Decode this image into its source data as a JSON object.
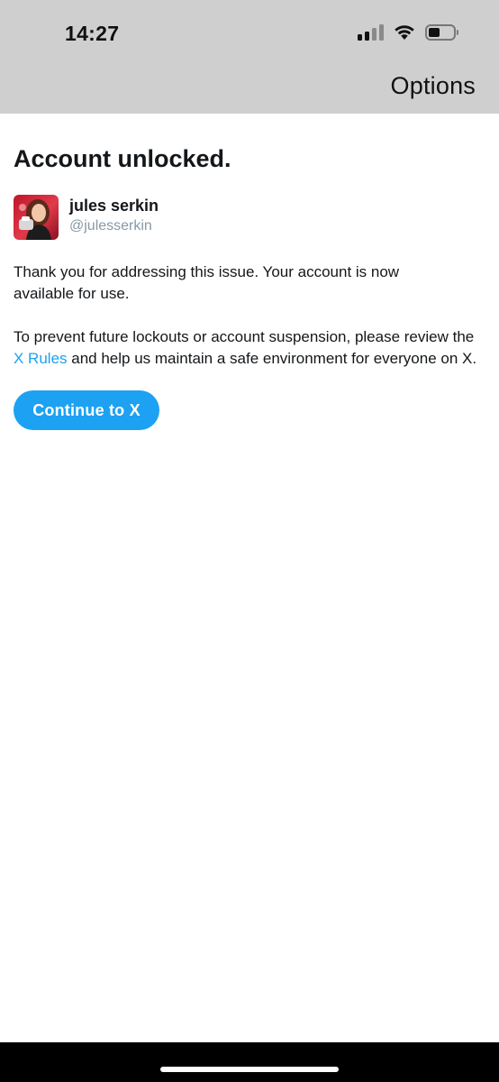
{
  "status_bar": {
    "time": "14:27",
    "icons": [
      "cellular-signal-icon",
      "wifi-icon",
      "battery-icon"
    ],
    "battery_level": 0.45
  },
  "nav": {
    "options_label": "Options"
  },
  "main": {
    "title": "Account unlocked.",
    "account": {
      "name": "jules serkin",
      "handle": "@julesserkin"
    },
    "paragraph1": "Thank you for addressing this issue. Your account is now available for use.",
    "paragraph2_before": "To prevent future lockouts or account suspension, please review the ",
    "paragraph2_link": "X Rules",
    "paragraph2_after": " and help us maintain a safe environment for everyone on X.",
    "continue_label": "Continue to X"
  },
  "colors": {
    "accent": "#1da1f2",
    "header_bg": "#cfcfcf",
    "handle_gray": "#8899a6",
    "text": "#14171a"
  }
}
